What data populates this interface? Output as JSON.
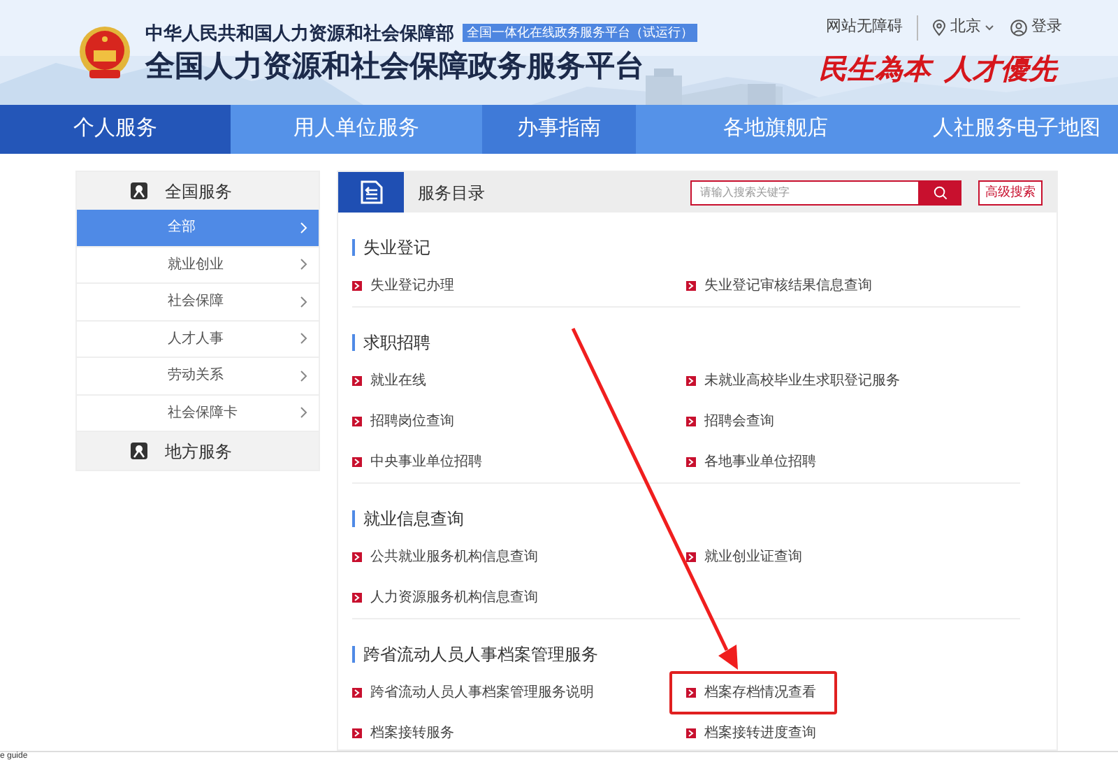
{
  "header": {
    "ministry": "中华人民共和国人力资源和社会保障部",
    "badge": "全国一体化在线政务服务平台（试运行）",
    "title": "全国人力资源和社会保障政务服务平台",
    "slogan": "民生為本  人才優先",
    "links": [
      {
        "kind": "plain",
        "label": "网站无障碍"
      },
      {
        "kind": "location",
        "label": "北京"
      },
      {
        "kind": "login",
        "label": "登录"
      }
    ]
  },
  "nav": [
    {
      "label": "个人服务",
      "selected": true,
      "highlighted": false
    },
    {
      "label": "用人单位服务",
      "selected": false,
      "highlighted": false
    },
    {
      "label": "办事指南",
      "selected": false,
      "highlighted": true
    },
    {
      "label": "各地旗舰店",
      "selected": false,
      "highlighted": false
    },
    {
      "label": "人社服务电子地图",
      "selected": false,
      "highlighted": false
    }
  ],
  "sidebar": {
    "groups": [
      {
        "label": "全国服务",
        "items": [
          {
            "label": "全部",
            "selected": true
          },
          {
            "label": "就业创业",
            "selected": false
          },
          {
            "label": "社会保障",
            "selected": false
          },
          {
            "label": "人才人事",
            "selected": false
          },
          {
            "label": "劳动关系",
            "selected": false
          },
          {
            "label": "社会保障卡",
            "selected": false
          }
        ]
      },
      {
        "label": "地方服务"
      }
    ]
  },
  "catalog": {
    "title": "服务目录",
    "search": {
      "placeholder": "请输入搜索关键字"
    },
    "advanced_search": "高级搜索",
    "sections": [
      {
        "title": "失业登记",
        "items": [
          {
            "label": "失业登记办理",
            "highlighted": false
          },
          {
            "label": "失业登记审核结果信息查询",
            "highlighted": false
          }
        ]
      },
      {
        "title": "求职招聘",
        "items": [
          {
            "label": "就业在线",
            "highlighted": false
          },
          {
            "label": "未就业高校毕业生求职登记服务",
            "highlighted": false
          },
          {
            "label": "招聘岗位查询",
            "highlighted": false
          },
          {
            "label": "招聘会查询",
            "highlighted": false
          },
          {
            "label": "中央事业单位招聘",
            "highlighted": false
          },
          {
            "label": "各地事业单位招聘",
            "highlighted": false
          }
        ]
      },
      {
        "title": "就业信息查询",
        "items": [
          {
            "label": "公共就业服务机构信息查询",
            "highlighted": false
          },
          {
            "label": "就业创业证查询",
            "highlighted": false
          },
          {
            "label": "人力资源服务机构信息查询",
            "highlighted": false
          }
        ]
      },
      {
        "title": "跨省流动人员人事档案管理服务",
        "items": [
          {
            "label": "跨省流动人员人事档案管理服务说明",
            "highlighted": false
          },
          {
            "label": "档案存档情况查看",
            "highlighted": true
          },
          {
            "label": "档案接转服务",
            "highlighted": false
          },
          {
            "label": "档案接转进度查询",
            "highlighted": false
          }
        ]
      }
    ]
  },
  "status_bar": "e guide"
}
